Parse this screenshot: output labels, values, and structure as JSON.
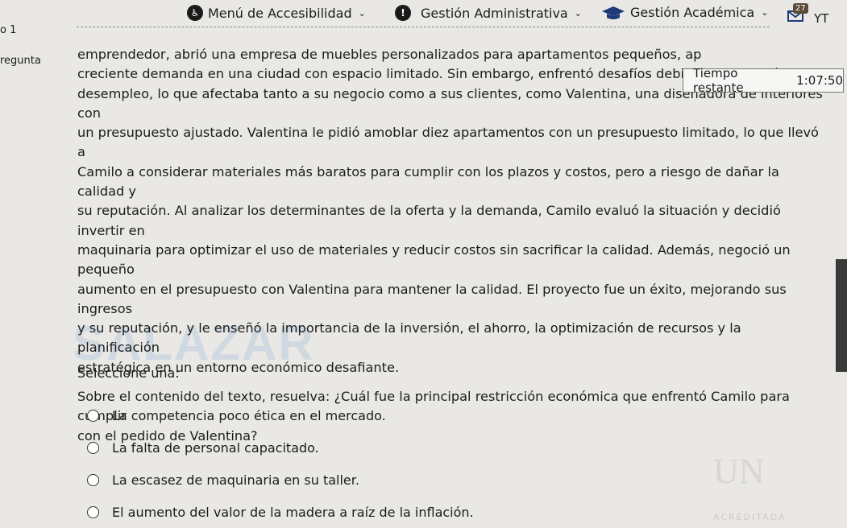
{
  "header": {
    "accessibility_menu": "Menú de Accesibilidad",
    "admin_menu": "Gestión Administrativa",
    "academic_menu": "Gestión Académica",
    "notification_count": "27",
    "user_initials": "YT"
  },
  "question_number": "o 1",
  "side_label": "regunta",
  "timer": {
    "label": "Tiempo restante",
    "value": "1:07:50"
  },
  "passage": [
    "emprendedor, abrió una empresa de muebles personalizados para apartamentos pequeños, ap",
    "creciente demanda en una ciudad con espacio limitado. Sin embargo, enfrentó desafíos debido a la inflación y el",
    "desempleo, lo que afectaba tanto a su negocio como a sus clientes, como Valentina, una diseñadora de interiores con",
    "un presupuesto ajustado. Valentina le pidió amoblar diez apartamentos con un presupuesto limitado, lo que llevó a",
    "Camilo a considerar materiales más baratos para cumplir con los plazos y costos, pero a riesgo de dañar la calidad y",
    "su reputación. Al analizar los determinantes de la oferta y la demanda, Camilo evaluó la situación y decidió invertir en",
    "maquinaria para optimizar el uso de materiales y reducir costos sin sacrificar la calidad. Además, negoció un pequeño",
    "aumento en el presupuesto con Valentina para mantener la calidad. El proyecto fue un éxito, mejorando sus ingresos",
    "y su reputación, y le enseñó la importancia de la inversión, el ahorro, la optimización de recursos y la planificación",
    "estratégica en un entorno económico desafiante."
  ],
  "question": [
    "Sobre el contenido del texto, resuelva: ¿Cuál fue la principal restricción económica que enfrentó Camilo para cumplir",
    "con el pedido de Valentina?"
  ],
  "select_label": "Seleccione una:",
  "options": [
    "La competencia poco ética en el mercado.",
    "La falta de personal capacitado.",
    "La escasez de maquinaria en su taller.",
    "El aumento del valor de la madera a raíz de la inflación."
  ],
  "watermark": {
    "name": "SALAZAR",
    "logo": "UN",
    "accreditation": "ACREDITADA"
  },
  "colors": {
    "background": "#e9e8e4",
    "graduation_cap": "#1f3a78",
    "alert_icon": "#1a1a1a",
    "accessibility_icon": "#1a1a1a",
    "watermark_fill": "#cdd8e4"
  }
}
